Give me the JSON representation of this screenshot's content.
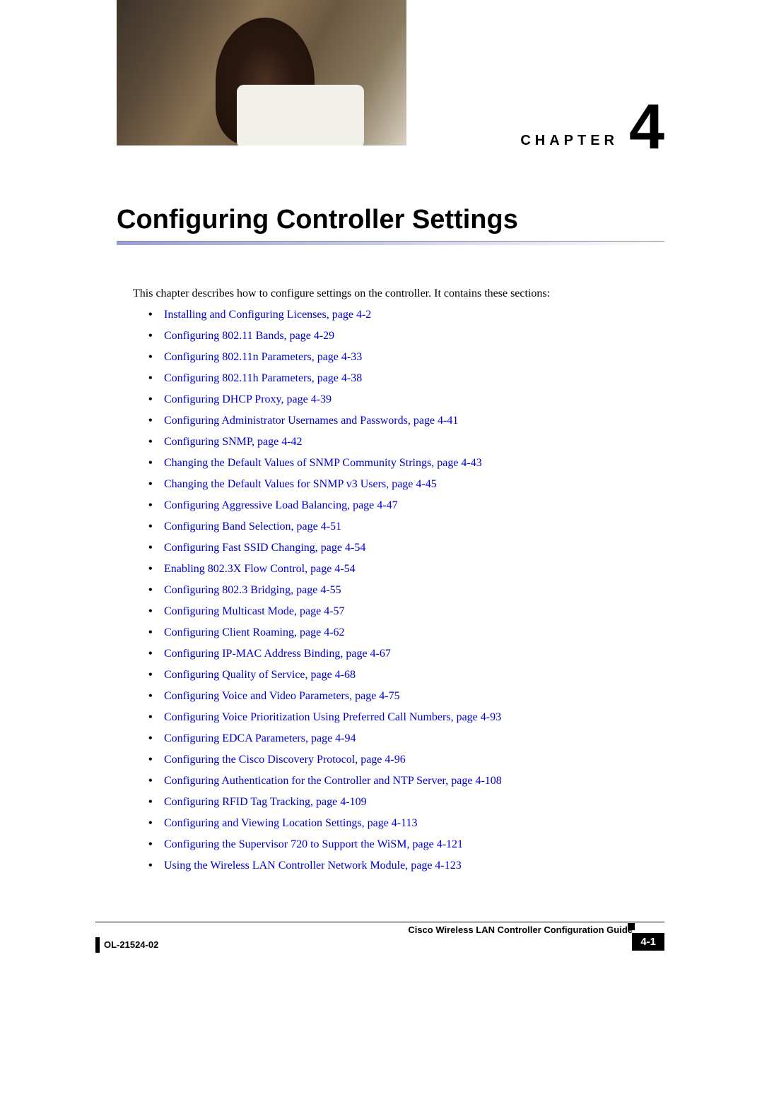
{
  "chapter": {
    "label": "CHAPTER",
    "number": "4",
    "title": "Configuring Controller Settings"
  },
  "intro": "This chapter describes how to configure settings on the controller. It contains these sections:",
  "toc": [
    {
      "text": "Installing and Configuring Licenses, page 4-2"
    },
    {
      "text": "Configuring 802.11 Bands, page 4-29"
    },
    {
      "text": "Configuring 802.11n Parameters, page 4-33"
    },
    {
      "text": "Configuring 802.11h Parameters, page 4-38"
    },
    {
      "text": "Configuring DHCP Proxy, page 4-39"
    },
    {
      "text": "Configuring Administrator Usernames and Passwords, page 4-41"
    },
    {
      "text": "Configuring SNMP, page 4-42"
    },
    {
      "text": "Changing the Default Values of SNMP Community Strings, page 4-43"
    },
    {
      "text": "Changing the Default Values for SNMP v3 Users, page 4-45"
    },
    {
      "text": "Configuring Aggressive Load Balancing, page 4-47"
    },
    {
      "text": "Configuring Band Selection, page 4-51"
    },
    {
      "text": "Configuring Fast SSID Changing, page 4-54"
    },
    {
      "text": "Enabling 802.3X Flow Control, page 4-54"
    },
    {
      "text": "Configuring 802.3 Bridging, page 4-55"
    },
    {
      "text": "Configuring Multicast Mode, page 4-57"
    },
    {
      "text": "Configuring Client Roaming, page 4-62"
    },
    {
      "text": "Configuring IP-MAC Address Binding, page 4-67"
    },
    {
      "text": "Configuring Quality of Service, page 4-68"
    },
    {
      "text": "Configuring Voice and Video Parameters, page 4-75"
    },
    {
      "text": "Configuring Voice Prioritization Using Preferred Call Numbers, page 4-93"
    },
    {
      "text": "Configuring EDCA Parameters, page 4-94"
    },
    {
      "text": "Configuring the Cisco Discovery Protocol, page 4-96"
    },
    {
      "text": "Configuring Authentication for the Controller and NTP Server, page 4-108"
    },
    {
      "text": "Configuring RFID Tag Tracking, page 4-109"
    },
    {
      "text": "Configuring and Viewing Location Settings, page 4-113"
    },
    {
      "text": "Configuring the Supervisor 720 to Support the WiSM, page 4-121"
    },
    {
      "text": "Using the Wireless LAN Controller Network Module, page 4-123"
    }
  ],
  "footer": {
    "book_title": "Cisco Wireless LAN Controller Configuration Guide",
    "doc_id": "OL-21524-02",
    "page": "4-1"
  }
}
